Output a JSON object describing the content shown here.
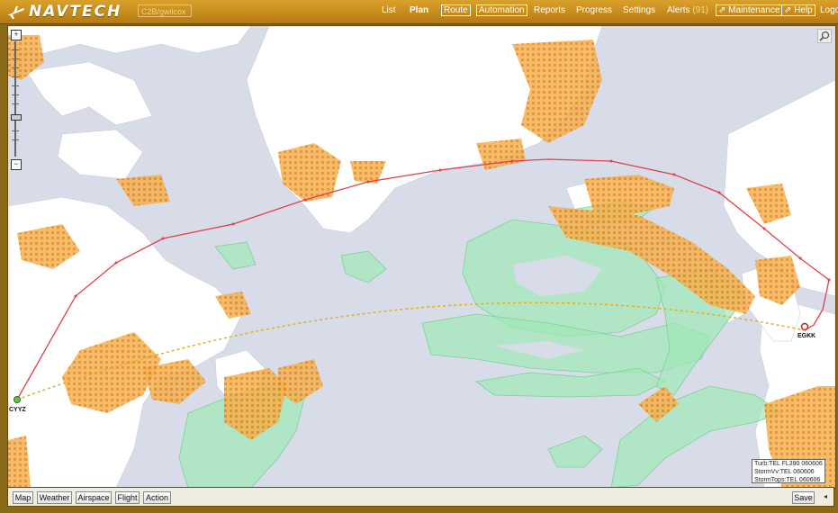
{
  "brand": {
    "logo_text": "NAVTECH"
  },
  "user": {
    "field_text": "C2B/gwilcox"
  },
  "nav": {
    "list": "List",
    "plan": "Plan",
    "route": "Route",
    "automation": "Automation",
    "reports": "Reports",
    "progress": "Progress",
    "settings": "Settings",
    "alerts": "Alerts",
    "alerts_count": "(91)",
    "maintenance": "Maintenance",
    "help": "Help",
    "logout": "Logo"
  },
  "map": {
    "airport_origin": "CYYZ",
    "airport_destination": "EGKK",
    "legend": {
      "line1": "Turb:TEL FL390 060606",
      "line2": "StormVv:TEL 060606",
      "line3": "StormTops:TEL 060606"
    }
  },
  "bottom": {
    "map": "Map",
    "weather": "Weather",
    "airspace": "Airspace",
    "flight": "Flight",
    "action": "Action",
    "save": "Save"
  },
  "colors": {
    "topbar": "#c58e1d",
    "route_line": "#e0404a",
    "great_circle": "#e0b020",
    "turb": "#f08a2a",
    "storm": "#9fe8b6",
    "land": "#ffffff",
    "water": "#d7dce8"
  }
}
